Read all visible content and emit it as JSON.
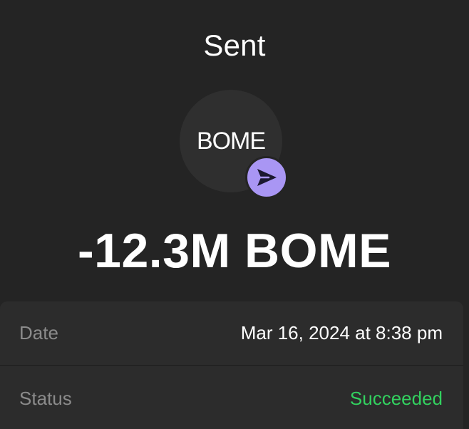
{
  "header": {
    "title": "Sent"
  },
  "token": {
    "symbol": "BOME",
    "badge_icon": "paper-plane-send-icon",
    "badge_color": "#a996f4"
  },
  "transaction": {
    "amount": "-12.3M BOME"
  },
  "details": {
    "date": {
      "label": "Date",
      "value": "Mar 16, 2024 at 8:38 pm"
    },
    "status": {
      "label": "Status",
      "value": "Succeeded",
      "color": "#32d15f"
    }
  }
}
